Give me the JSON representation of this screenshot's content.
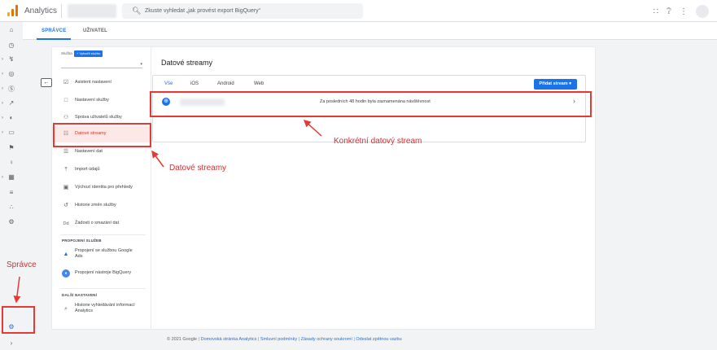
{
  "app": {
    "title": "Analytics"
  },
  "search": {
    "placeholder": "Zkuste vyhledat „jak provést export BigQuery“"
  },
  "tabs": [
    {
      "label": "SPRÁVCE"
    },
    {
      "label": "UŽIVATEL"
    }
  ],
  "property": {
    "label": "Služba",
    "create_button": "+ Vytvořit službu"
  },
  "nav": {
    "items": [
      {
        "label": "Asistent nastavení",
        "icon": "checkbox-icon"
      },
      {
        "label": "Nastavení služby",
        "icon": "settings-page-icon"
      },
      {
        "label": "Správa uživatelů služby",
        "icon": "people-icon"
      },
      {
        "label": "Datové streamy",
        "icon": "streams-icon"
      },
      {
        "label": "Nastavení dat",
        "icon": "database-icon"
      },
      {
        "label": "Import údajů",
        "icon": "upload-icon"
      },
      {
        "label": "Výchozí identita pro přehledy",
        "icon": "identity-icon"
      },
      {
        "label": "Historie změn služby",
        "icon": "history-icon"
      },
      {
        "label": "Žádosti o smazání dat",
        "icon": "dd-icon"
      }
    ],
    "section_links_title": "PROPOJENÍ SLUŽEB",
    "links": [
      {
        "label": "Propojení se službou Google Ads",
        "icon": "google-ads-icon"
      },
      {
        "label": "Propojení nástroje BigQuery",
        "icon": "bigquery-icon"
      }
    ],
    "section_more_title": "DALŠÍ NASTAVENÍ",
    "more": [
      {
        "label": "Historie vyhledávání informací Analytics",
        "icon": "search-history-icon"
      }
    ]
  },
  "streams": {
    "title": "Datové streamy",
    "filters": [
      "Vše",
      "iOS",
      "Android",
      "Web"
    ],
    "add_button": "Přidat stream ▾",
    "row_status": "Za posledních 48 hodin byla zaznamenána návštěvnost"
  },
  "footer": {
    "copyright": "© 2021 Google",
    "links": [
      "Domovská stránka Analytics",
      "Smluvní podmínky",
      "Zásady ochrany soukromí",
      "Odeslat zpětnou vazbu"
    ]
  },
  "annotations": {
    "stream_label": "Konkrétní datový stream",
    "datastreams_label": "Datové streamy",
    "admin_label": "Správce"
  },
  "colors": {
    "accent": "#1a73e8",
    "annotation": "#e53935",
    "active_nav_bg": "#fce8e6"
  }
}
